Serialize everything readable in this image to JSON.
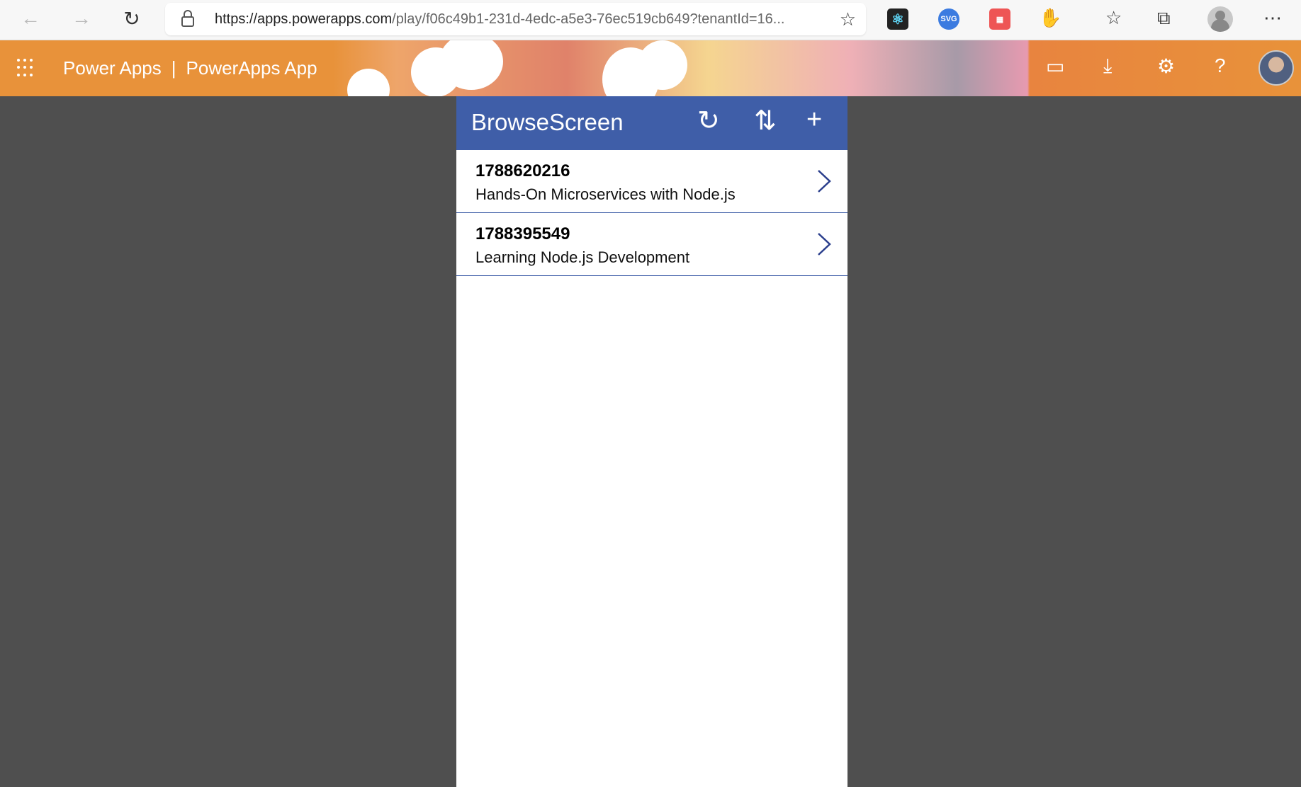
{
  "browser": {
    "url_host": "https://apps.powerapps.com",
    "url_path": "/play/f06c49b1-231d-4edc-a5e3-76ec519cb649?tenantId=16...",
    "ext_svg": "SVG"
  },
  "header": {
    "app_brand": "Power Apps",
    "separator": "|",
    "app_name": "PowerApps App"
  },
  "screen": {
    "title": "BrowseScreen"
  },
  "items": [
    {
      "id": "1788620216",
      "title": "Hands-On Microservices with Node.js"
    },
    {
      "id": "1788395549",
      "title": "Learning Node.js Development"
    }
  ],
  "colors": {
    "accent": "#3f5ea8",
    "header": "#e8923a"
  }
}
